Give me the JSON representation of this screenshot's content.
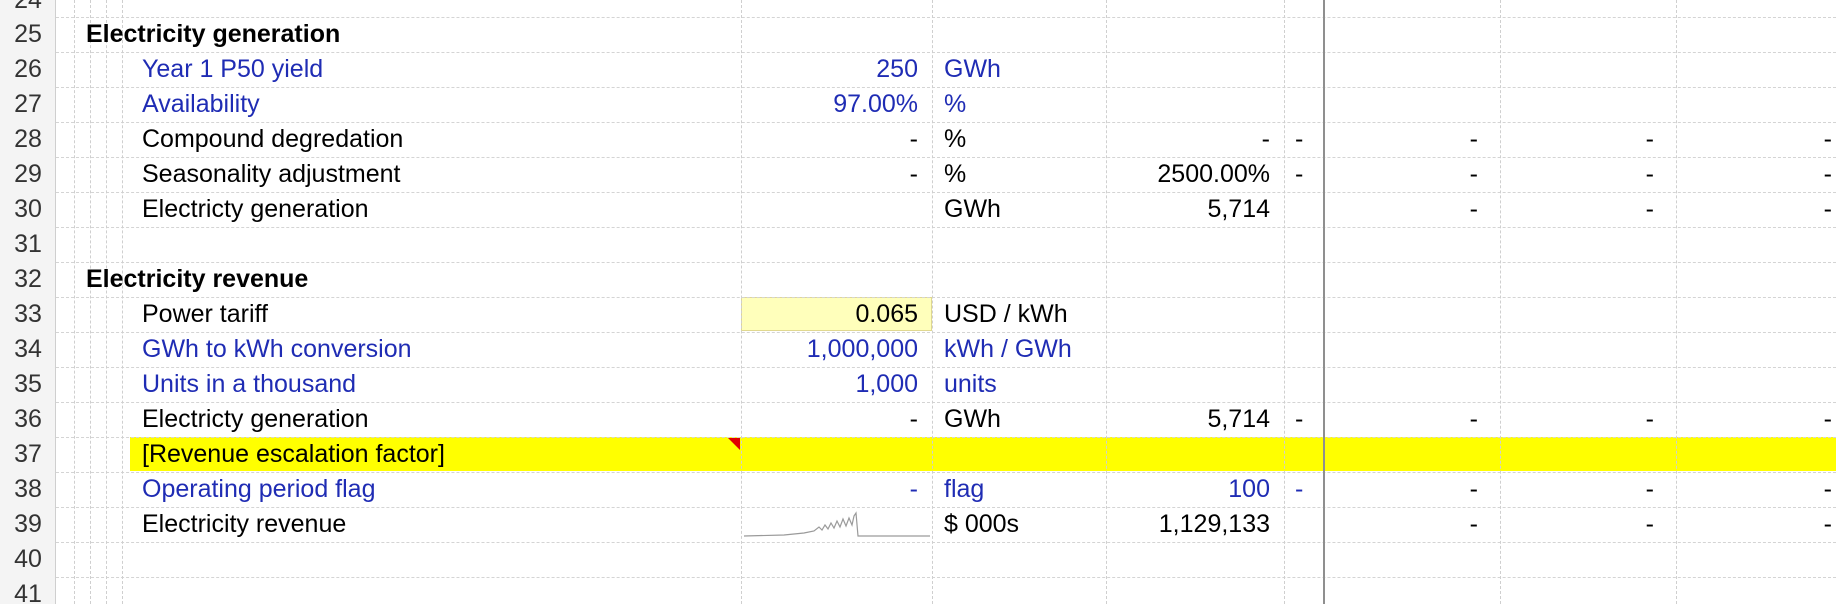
{
  "row_numbers": [
    "24",
    "25",
    "26",
    "27",
    "28",
    "29",
    "30",
    "31",
    "32",
    "33",
    "34",
    "35",
    "36",
    "37",
    "38",
    "39",
    "40",
    "41"
  ],
  "sections": {
    "generation_header": "Electricity generation",
    "revenue_header": "Electricity revenue"
  },
  "rows": {
    "r26": {
      "label": "Year 1 P50 yield",
      "value": "250",
      "unit": "GWh"
    },
    "r27": {
      "label": "Availability",
      "value": "97.00%",
      "unit": "%"
    },
    "r28": {
      "label": "Compound degredation",
      "value": "-",
      "unit": "%",
      "total": "-",
      "c1": "-",
      "c2": "-",
      "c3": "-",
      "c4": "-"
    },
    "r29": {
      "label": "Seasonality adjustment",
      "value": "-",
      "unit": "%",
      "total": "2500.00%",
      "c1": "-",
      "c2": "-",
      "c3": "-",
      "c4": "-"
    },
    "r30": {
      "label": "Electricty generation",
      "unit": "GWh",
      "total": "5,714",
      "c2": "-",
      "c3": "-",
      "c4": "-"
    },
    "r33": {
      "label": "Power tariff",
      "value": "0.065",
      "unit": "USD / kWh"
    },
    "r34": {
      "label": "GWh to kWh conversion",
      "value": "1,000,000",
      "unit": "kWh / GWh"
    },
    "r35": {
      "label": "Units in a thousand",
      "value": "1,000",
      "unit": "units"
    },
    "r36": {
      "label": "Electricty generation",
      "value": "-",
      "unit": "GWh",
      "total": "5,714",
      "c1": "-",
      "c2": "-",
      "c3": "-",
      "c4": "-"
    },
    "r37": {
      "label": "[Revenue escalation factor]"
    },
    "r38": {
      "label": "Operating period flag",
      "value": "-",
      "unit": "flag",
      "total": "100",
      "c1": "-",
      "c2": "-",
      "c3": "-",
      "c4": "-"
    },
    "r39": {
      "label": "Electricity revenue",
      "unit": "$ 000s",
      "total": "1,129,133",
      "c2": "-",
      "c3": "-",
      "c4": "-"
    }
  },
  "colors": {
    "input_blue": "#1f2cb4",
    "highlight_yellow": "#ffff00",
    "input_cell_fill": "#ffffbb",
    "comment_marker": "#e00000"
  }
}
